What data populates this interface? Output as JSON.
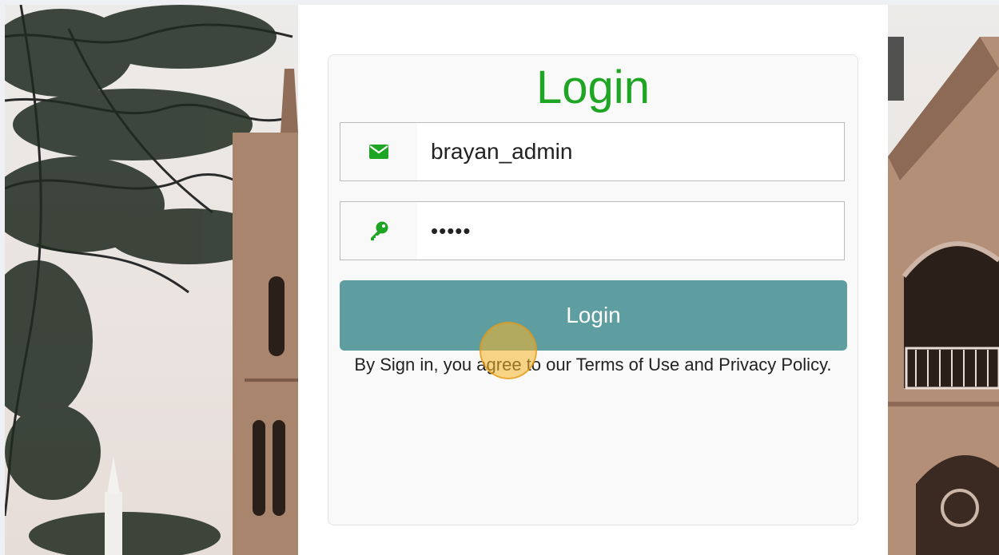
{
  "login": {
    "title": "Login",
    "username_value": "brayan_admin",
    "password_value": "•••••",
    "button_label": "Login",
    "terms_text": "By Sign in, you agree to our Terms of Use and Privacy Policy."
  },
  "icons": {
    "username_icon": "envelope-icon",
    "password_icon": "key-icon"
  },
  "colors": {
    "title": "#1fa524",
    "icon": "#1fa524",
    "button": "#5f9ea0"
  }
}
